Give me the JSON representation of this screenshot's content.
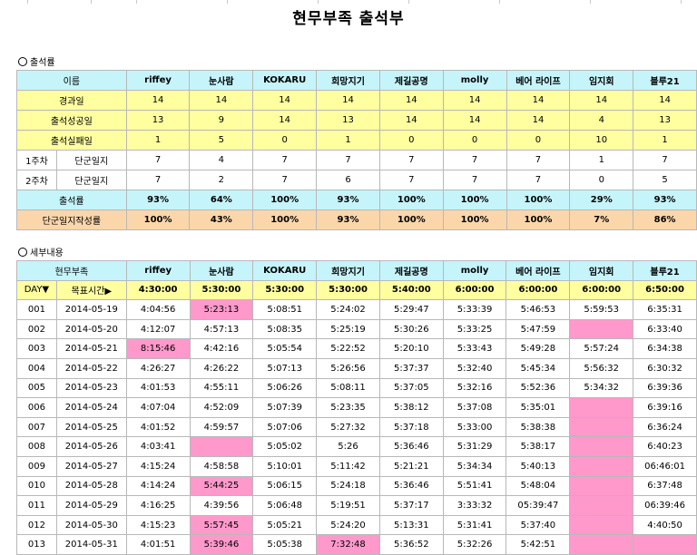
{
  "title": "현무부족 출석부",
  "section1": "출석률",
  "section2": "세부내용",
  "names": [
    "riffey",
    "눈사람",
    "KOKARU",
    "희망지기",
    "제길공명",
    "molly",
    "베어 라이프",
    "임지회",
    "블루21"
  ],
  "summary": {
    "header": "이름",
    "elapsed": {
      "label": "경과일",
      "values": [
        "14",
        "14",
        "14",
        "14",
        "14",
        "14",
        "14",
        "14",
        "14"
      ]
    },
    "success": {
      "label": "출석성공일",
      "values": [
        "13",
        "9",
        "14",
        "13",
        "14",
        "14",
        "14",
        "4",
        "13"
      ]
    },
    "fail": {
      "label": "출석실패일",
      "values": [
        "1",
        "5",
        "0",
        "1",
        "0",
        "0",
        "0",
        "10",
        "1"
      ]
    },
    "w1": {
      "week": "1주차",
      "label": "단군일지",
      "values": [
        "7",
        "4",
        "7",
        "7",
        "7",
        "7",
        "7",
        "1",
        "7"
      ]
    },
    "w2": {
      "week": "2주차",
      "label": "단군일지",
      "values": [
        "7",
        "2",
        "7",
        "6",
        "7",
        "7",
        "7",
        "0",
        "5"
      ]
    },
    "rate": {
      "label": "출석률",
      "values": [
        "93%",
        "64%",
        "100%",
        "93%",
        "100%",
        "100%",
        "100%",
        "29%",
        "93%"
      ]
    },
    "journal": {
      "label": "단군일지작성률",
      "values": [
        "100%",
        "43%",
        "100%",
        "93%",
        "100%",
        "100%",
        "100%",
        "7%",
        "86%"
      ]
    }
  },
  "detail": {
    "header": "현무부족",
    "day_label": "DAY▼",
    "target_label": "목표시간▶",
    "targets": [
      "4:30:00",
      "5:30:00",
      "5:30:00",
      "5:30:00",
      "5:40:00",
      "6:00:00",
      "6:00:00",
      "6:00:00",
      "6:50:00"
    ],
    "rows": [
      {
        "day": "001",
        "date": "2014-05-19",
        "cells": [
          {
            "v": "4:04:56"
          },
          {
            "v": "5:23:13",
            "pink": true
          },
          {
            "v": "5:08:51"
          },
          {
            "v": "5:24:02"
          },
          {
            "v": "5:29:47"
          },
          {
            "v": "5:33:39"
          },
          {
            "v": "5:46:53"
          },
          {
            "v": "5:59:53"
          },
          {
            "v": "6:35:31"
          }
        ]
      },
      {
        "day": "002",
        "date": "2014-05-20",
        "cells": [
          {
            "v": "4:12:07"
          },
          {
            "v": "4:57:13"
          },
          {
            "v": "5:08:35"
          },
          {
            "v": "5:25:19"
          },
          {
            "v": "5:30:26"
          },
          {
            "v": "5:33:25"
          },
          {
            "v": "5:47:59"
          },
          {
            "v": "",
            "pink": true
          },
          {
            "v": "6:33:40"
          }
        ]
      },
      {
        "day": "003",
        "date": "2014-05-21",
        "cells": [
          {
            "v": "8:15:46",
            "pink": true
          },
          {
            "v": "4:42:16"
          },
          {
            "v": "5:05:54"
          },
          {
            "v": "5:22:52"
          },
          {
            "v": "5:20:10"
          },
          {
            "v": "5:33:43"
          },
          {
            "v": "5:49:28"
          },
          {
            "v": "5:57:24"
          },
          {
            "v": "6:34:38"
          }
        ]
      },
      {
        "day": "004",
        "date": "2014-05-22",
        "cells": [
          {
            "v": "4:26:27"
          },
          {
            "v": "4:26:22"
          },
          {
            "v": "5:07:13"
          },
          {
            "v": "5:26:56"
          },
          {
            "v": "5:37:37"
          },
          {
            "v": "5:32:40"
          },
          {
            "v": "5:45:34"
          },
          {
            "v": "5:56:32"
          },
          {
            "v": "6:30:32"
          }
        ]
      },
      {
        "day": "005",
        "date": "2014-05-23",
        "cells": [
          {
            "v": "4:01:53"
          },
          {
            "v": "4:55:11"
          },
          {
            "v": "5:06:26"
          },
          {
            "v": "5:08:11"
          },
          {
            "v": "5:37:05"
          },
          {
            "v": "5:32:16"
          },
          {
            "v": "5:52:36"
          },
          {
            "v": "5:34:32"
          },
          {
            "v": "6:39:36"
          }
        ]
      },
      {
        "day": "006",
        "date": "2014-05-24",
        "cells": [
          {
            "v": "4:07:04"
          },
          {
            "v": "4:52:09"
          },
          {
            "v": "5:07:39"
          },
          {
            "v": "5:23:35"
          },
          {
            "v": "5:38:12"
          },
          {
            "v": "5:37:08"
          },
          {
            "v": "5:35:01"
          },
          {
            "v": "",
            "pink": true
          },
          {
            "v": "6:39:16"
          }
        ]
      },
      {
        "day": "007",
        "date": "2014-05-25",
        "cells": [
          {
            "v": "4:01:52"
          },
          {
            "v": "4:59:57"
          },
          {
            "v": "5:07:06"
          },
          {
            "v": "5:27:32"
          },
          {
            "v": "5:37:18"
          },
          {
            "v": "5:33:00"
          },
          {
            "v": "5:38:38"
          },
          {
            "v": "",
            "pink": true
          },
          {
            "v": "6:36:24"
          }
        ]
      },
      {
        "day": "008",
        "date": "2014-05-26",
        "cells": [
          {
            "v": "4:03:41"
          },
          {
            "v": "",
            "pink": true
          },
          {
            "v": "5:05:02"
          },
          {
            "v": "5:26"
          },
          {
            "v": "5:36:46"
          },
          {
            "v": "5:31:29"
          },
          {
            "v": "5:38:17"
          },
          {
            "v": "",
            "pink": true
          },
          {
            "v": "6:40:23"
          }
        ]
      },
      {
        "day": "009",
        "date": "2014-05-27",
        "cells": [
          {
            "v": "4:15:24"
          },
          {
            "v": "4:58:58"
          },
          {
            "v": "5:10:01"
          },
          {
            "v": "5:11:42"
          },
          {
            "v": "5:21:21"
          },
          {
            "v": "5:34:34"
          },
          {
            "v": "5:40:13"
          },
          {
            "v": "",
            "pink": true
          },
          {
            "v": "06:46:01"
          }
        ]
      },
      {
        "day": "010",
        "date": "2014-05-28",
        "cells": [
          {
            "v": "4:14:24"
          },
          {
            "v": "5:44:25",
            "pink": true
          },
          {
            "v": "5:06:15"
          },
          {
            "v": "5:24:18"
          },
          {
            "v": "5:36:46"
          },
          {
            "v": "5:51:41"
          },
          {
            "v": "5:48:04"
          },
          {
            "v": "",
            "pink": true
          },
          {
            "v": "6:37:48"
          }
        ]
      },
      {
        "day": "011",
        "date": "2014-05-29",
        "cells": [
          {
            "v": "4:16:25"
          },
          {
            "v": "4:39:56"
          },
          {
            "v": "5:06:48"
          },
          {
            "v": "5:19:51"
          },
          {
            "v": "5:37:17"
          },
          {
            "v": "3:33:32"
          },
          {
            "v": "05:39:47"
          },
          {
            "v": "",
            "pink": true
          },
          {
            "v": "06:39:46"
          }
        ]
      },
      {
        "day": "012",
        "date": "2014-05-30",
        "cells": [
          {
            "v": "4:15:23"
          },
          {
            "v": "5:57:45",
            "pink": true
          },
          {
            "v": "5:05:21"
          },
          {
            "v": "5:24:20"
          },
          {
            "v": "5:13:31"
          },
          {
            "v": "5:31:41"
          },
          {
            "v": "5:37:40"
          },
          {
            "v": "",
            "pink": true
          },
          {
            "v": "4:40:50"
          }
        ]
      },
      {
        "day": "013",
        "date": "2014-05-31",
        "cells": [
          {
            "v": "4:01:51"
          },
          {
            "v": "5:39:46",
            "pink": true
          },
          {
            "v": "5:05:38"
          },
          {
            "v": "7:32:48",
            "pink": true
          },
          {
            "v": "5:36:52"
          },
          {
            "v": "5:32:26"
          },
          {
            "v": "5:42:51"
          },
          {
            "v": "",
            "pink": true
          },
          {
            "v": "",
            "pink": true
          }
        ]
      }
    ]
  }
}
